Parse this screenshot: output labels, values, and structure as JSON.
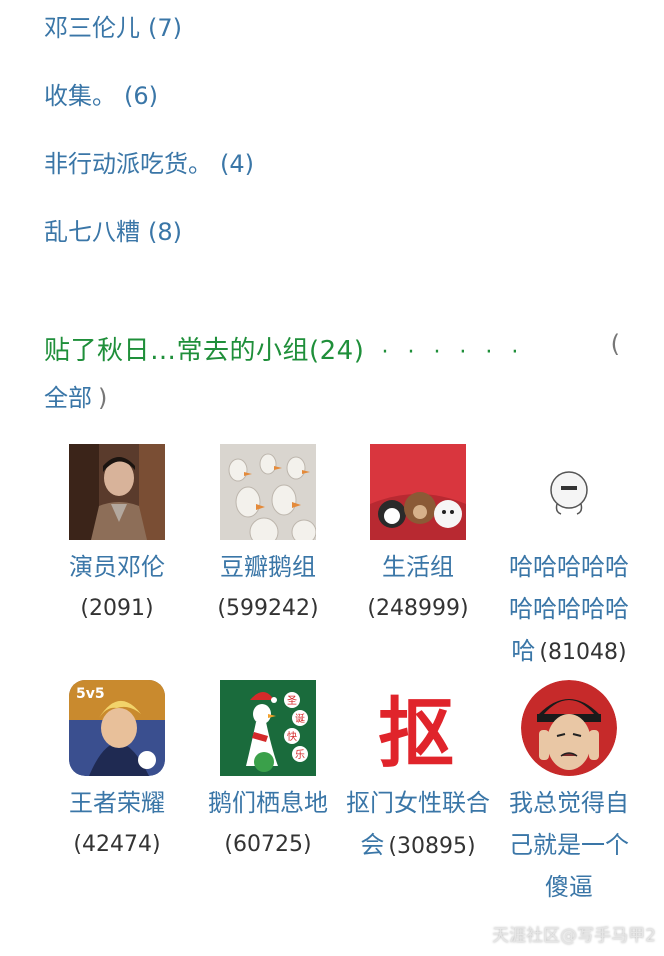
{
  "albums": [
    {
      "name": "邓三伦儿",
      "count": "(7)"
    },
    {
      "name": "收集。",
      "count": "(6)"
    },
    {
      "name": "非行动派吃货。",
      "count": "(4)"
    },
    {
      "name": "乱七八糟",
      "count": "(8)"
    }
  ],
  "section": {
    "title": "贴了秋日…常去的小组(24)",
    "dots": "· · · · · ·",
    "open_paren": "(",
    "all_label": "全部",
    "close_paren": ")"
  },
  "groups": [
    {
      "name": "演员邓伦",
      "count": "(2091)"
    },
    {
      "name": "豆瓣鹅组",
      "count": "(599242)"
    },
    {
      "name": "生活组",
      "count": "(248999)"
    },
    {
      "name": "哈哈哈哈哈哈哈哈哈哈哈",
      "count": "(81048)"
    },
    {
      "name": "王者荣耀",
      "count": "(42474)"
    },
    {
      "name": "鹅们栖息地",
      "count": "(60725)"
    },
    {
      "name": "抠门女性联合会",
      "count": "(30895)"
    },
    {
      "name": "我总觉得自己就是一个傻逼",
      "count": ""
    }
  ],
  "icons": {
    "g5_badge": "5v5",
    "g6_tag1": "圣",
    "g6_tag2": "诞",
    "g6_tag3": "快",
    "g6_tag4": "乐",
    "g7_char": "抠"
  },
  "watermark": "天涯社区@写手马甲2",
  "colors": {
    "link": "#3a76a7",
    "title": "#1f8f3a"
  }
}
